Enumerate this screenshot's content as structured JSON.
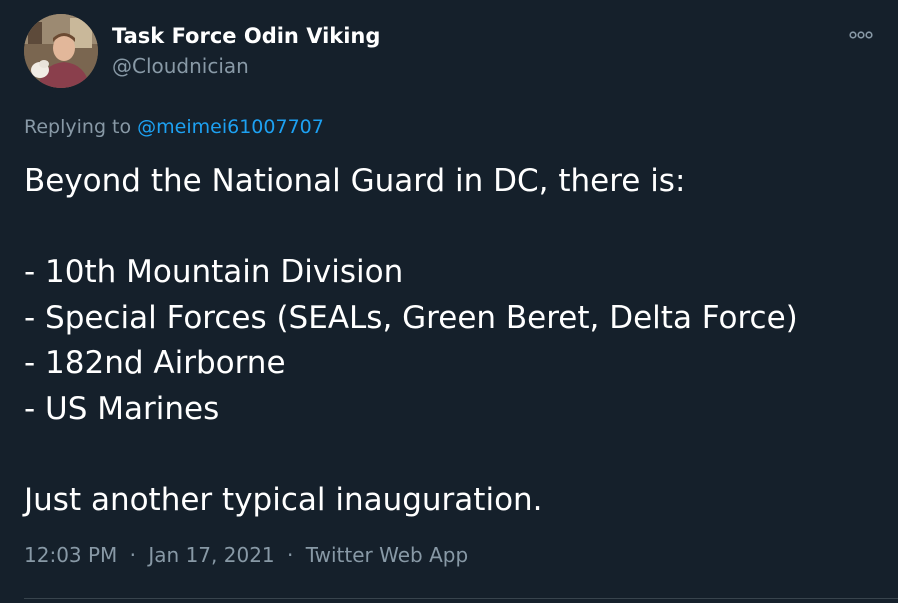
{
  "author": {
    "display_name": "Task Force Odin Viking",
    "handle": "@Cloudnician",
    "avatar_icon": "profile-photo"
  },
  "more_icon": "more-horizontal-icon",
  "reply": {
    "prefix": "Replying to",
    "mention": "@meimei61007707"
  },
  "tweet": {
    "lines": [
      "Beyond the National Guard in DC, there is:",
      "",
      "- 10th Mountain Division",
      "- Special Forces (SEALs, Green Beret, Delta Force)",
      "- 182nd Airborne",
      "- US Marines",
      "",
      "Just another typical inauguration."
    ]
  },
  "meta": {
    "time": "12:03 PM",
    "date": "Jan 17, 2021",
    "source": "Twitter Web App",
    "separator": "·"
  },
  "colors": {
    "background": "#15202b",
    "text_primary": "#ffffff",
    "text_secondary": "#8899a6",
    "link": "#1da1f2",
    "divider": "#38444d"
  }
}
